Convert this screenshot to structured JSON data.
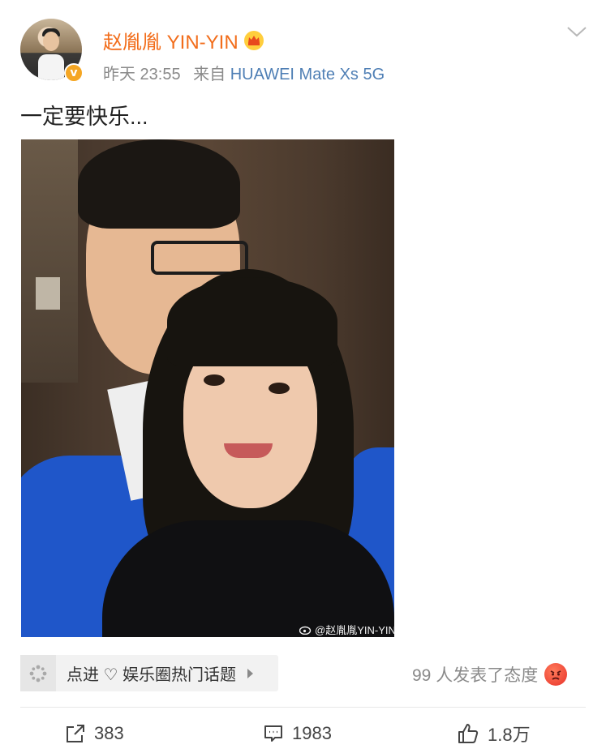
{
  "post": {
    "username": "赵胤胤 YIN-YIN",
    "time": "昨天 23:55",
    "source_prefix": "来自",
    "source": "HUAWEI Mate Xs 5G",
    "text": "一定要快乐...",
    "watermark": "@赵胤胤YIN-YIN"
  },
  "topic": {
    "label": "点进 ♡ 娱乐圈热门话题"
  },
  "attitude": {
    "label": "99 人发表了态度"
  },
  "actions": {
    "repost_count": "383",
    "comment_count": "1983",
    "like_count": "1.8万"
  },
  "colors": {
    "username": "#f26d1b",
    "source_link": "#4f7fb5",
    "verified_badge": "#f5a623",
    "secondary_text": "#8a8a8a"
  },
  "icons": {
    "verified": "verified-badge-icon",
    "crown": "crown-icon",
    "menu": "chevron-down-icon",
    "topic": "sparkle-icon",
    "attitude": "angry-face-icon",
    "repost": "share-icon",
    "comment": "comment-icon",
    "like": "thumbs-up-icon"
  }
}
